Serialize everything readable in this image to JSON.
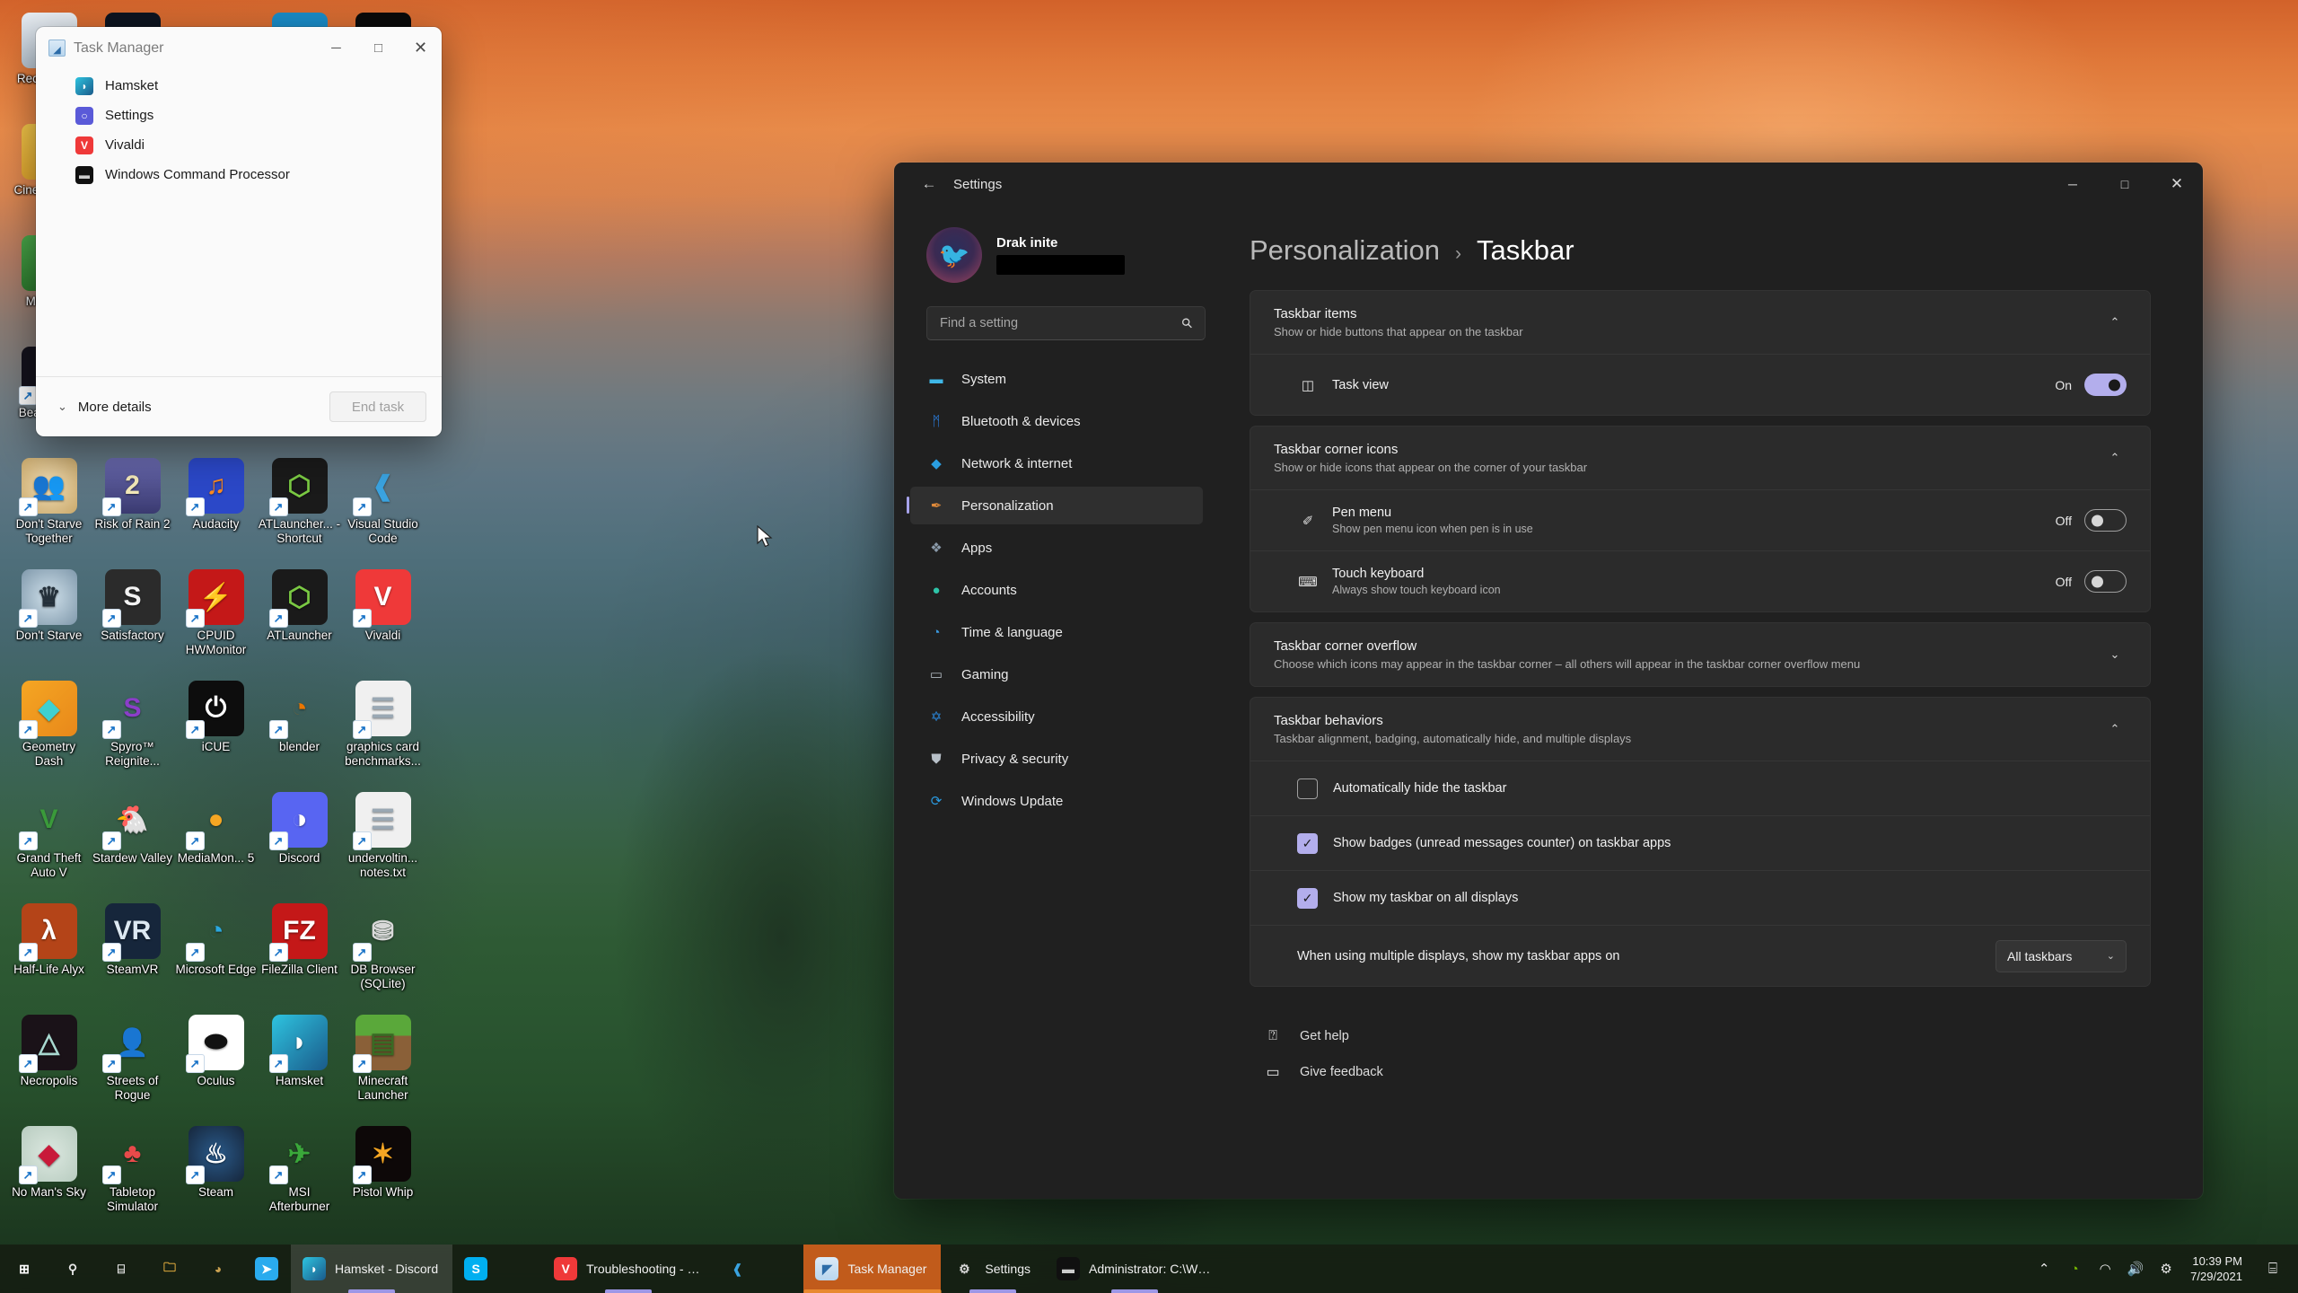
{
  "desktop": {
    "icons": [
      {
        "label": "Recycle Bin",
        "icon": "recycle-bin-icon",
        "glyph": "♻",
        "bg": "linear-gradient(180deg,#e8edf2,#b9c6d2)",
        "color": "#1e7ac8",
        "shortcut": false
      },
      {
        "label": "",
        "icon": "monster-hunter-icon",
        "glyph": "⚔",
        "bg": "#0d1420",
        "color": "#e8eef5",
        "shortcut": false
      },
      {
        "label": "",
        "icon": "green-orb-icon",
        "glyph": "●",
        "bg": "transparent",
        "color": "#2bb24c",
        "shortcut": false
      },
      {
        "label": "",
        "icon": "blue-app-icon",
        "glyph": "▬",
        "bg": "#1a8cc8",
        "color": "#ffffff",
        "shortcut": false
      },
      {
        "label": "",
        "icon": "gauge-icon",
        "glyph": "◔",
        "bg": "#0a0a0a",
        "color": "#e6e6e6",
        "shortcut": false
      },
      {
        "label": "Cinebench R",
        "icon": "cinebench-icon",
        "glyph": "▮",
        "bg": "linear-gradient(180deg,#f5c84a,#e0a72f)",
        "color": "#7a5410",
        "shortcut": false
      },
      {
        "label": "",
        "icon": "placeholder-icon",
        "glyph": "",
        "bg": "transparent",
        "color": "#fff",
        "shortcut": false
      },
      {
        "label": "",
        "icon": "placeholder-icon",
        "glyph": "",
        "bg": "transparent",
        "color": "#fff",
        "shortcut": false
      },
      {
        "label": "",
        "icon": "placeholder-icon",
        "glyph": "",
        "bg": "transparent",
        "color": "#fff",
        "shortcut": false
      },
      {
        "label": "",
        "icon": "placeholder-icon",
        "glyph": "",
        "bg": "transparent",
        "color": "#fff",
        "shortcut": false
      },
      {
        "label": "Memtest",
        "icon": "memtest-ram-icon",
        "glyph": "⌸",
        "bg": "linear-gradient(180deg,#4aa84a,#2e7a2e)",
        "color": "#0d2a0d",
        "shortcut": false
      },
      {
        "label": "",
        "icon": "placeholder-icon",
        "glyph": "",
        "bg": "transparent",
        "color": "#fff",
        "shortcut": false
      },
      {
        "label": "",
        "icon": "placeholder-icon",
        "glyph": "",
        "bg": "transparent",
        "color": "#fff",
        "shortcut": false
      },
      {
        "label": "",
        "icon": "placeholder-icon",
        "glyph": "",
        "bg": "transparent",
        "color": "#fff",
        "shortcut": false
      },
      {
        "label": "",
        "icon": "placeholder-icon",
        "glyph": "",
        "bg": "transparent",
        "color": "#fff",
        "shortcut": false
      },
      {
        "label": "Beat Saber",
        "icon": "beat-saber-icon",
        "glyph": "◆",
        "bg": "#14121c",
        "color": "#e0365c",
        "shortcut": true
      },
      {
        "label": "",
        "icon": "placeholder-icon",
        "glyph": "",
        "bg": "transparent",
        "color": "#fff",
        "shortcut": false
      },
      {
        "label": "",
        "icon": "placeholder-icon",
        "glyph": "",
        "bg": "transparent",
        "color": "#fff",
        "shortcut": false
      },
      {
        "label": "",
        "icon": "placeholder-icon",
        "glyph": "",
        "bg": "transparent",
        "color": "#fff",
        "shortcut": false
      },
      {
        "label": "",
        "icon": "placeholder-icon",
        "glyph": "",
        "bg": "transparent",
        "color": "#fff",
        "shortcut": false
      },
      {
        "label": "Don't Starve Together",
        "icon": "dont-starve-together-icon",
        "glyph": "👥",
        "bg": "radial-gradient(circle,#f0dcb4,#c9a86a)",
        "color": "#3a2a18",
        "shortcut": true
      },
      {
        "label": "Risk of Rain 2",
        "icon": "risk-of-rain-2-icon",
        "glyph": "2",
        "bg": "linear-gradient(180deg,#6a6ab0,#3a3a70)",
        "color": "#f2e8b8",
        "shortcut": true
      },
      {
        "label": "Audacity",
        "icon": "audacity-icon",
        "glyph": "♫",
        "bg": "#2b48c8",
        "color": "#ff8a1e",
        "shortcut": true
      },
      {
        "label": "ATLauncher... - Shortcut",
        "icon": "atlauncher-shortcut-icon",
        "glyph": "⬡",
        "bg": "#1a1a1a",
        "color": "#7ac943",
        "shortcut": true
      },
      {
        "label": "Visual Studio Code",
        "icon": "visual-studio-code-icon",
        "glyph": "❰",
        "bg": "transparent",
        "color": "#3aa3e0",
        "shortcut": true
      },
      {
        "label": "Don't Starve",
        "icon": "dont-starve-icon",
        "glyph": "♛",
        "bg": "radial-gradient(circle,#cfe0ea,#7f98ab)",
        "color": "#24303a",
        "shortcut": true
      },
      {
        "label": "Satisfactory",
        "icon": "satisfactory-icon",
        "glyph": "S",
        "bg": "#2b2b2b",
        "color": "#f2f2f2",
        "shortcut": true
      },
      {
        "label": "CPUID HWMonitor",
        "icon": "cpuid-hwmonitor-icon",
        "glyph": "⚡",
        "bg": "#c41818",
        "color": "#ffffff",
        "shortcut": true
      },
      {
        "label": "ATLauncher",
        "icon": "atlauncher-icon",
        "glyph": "⬡",
        "bg": "#1a1a1a",
        "color": "#7ac943",
        "shortcut": true
      },
      {
        "label": "Vivaldi",
        "icon": "vivaldi-icon",
        "glyph": "V",
        "bg": "#ef3939",
        "color": "#ffffff",
        "shortcut": true
      },
      {
        "label": "Geometry Dash",
        "icon": "geometry-dash-icon",
        "glyph": "◆",
        "bg": "linear-gradient(135deg,#f5a623,#e8881a)",
        "color": "#3fd0d0",
        "shortcut": true
      },
      {
        "label": "Spyro™ Reignite...",
        "icon": "spyro-reignited-icon",
        "glyph": "S",
        "bg": "transparent",
        "color": "#8b3ec9",
        "shortcut": true
      },
      {
        "label": "iCUE",
        "icon": "icue-icon",
        "glyph": "⏻",
        "bg": "#0d0d0d",
        "color": "#ffffff",
        "shortcut": true
      },
      {
        "label": "blender",
        "icon": "blender-icon",
        "glyph": "◔",
        "bg": "transparent",
        "color": "#ea7600",
        "shortcut": true
      },
      {
        "label": "graphics card benchmarks...",
        "icon": "text-document-icon",
        "glyph": "☰",
        "bg": "#f0f0f0",
        "color": "#9aa8b4",
        "shortcut": true
      },
      {
        "label": "Grand Theft Auto V",
        "icon": "grand-theft-auto-v-icon",
        "glyph": "V",
        "bg": "transparent",
        "color": "#3a9a3a",
        "shortcut": true
      },
      {
        "label": "Stardew Valley",
        "icon": "stardew-valley-icon",
        "glyph": "🐔",
        "bg": "transparent",
        "color": "#e8c070",
        "shortcut": true
      },
      {
        "label": "MediaMon... 5",
        "icon": "mediamonkey-icon",
        "glyph": "●",
        "bg": "transparent",
        "color": "#f5a623",
        "shortcut": true
      },
      {
        "label": "Discord",
        "icon": "discord-icon",
        "glyph": "◑",
        "bg": "#5865f2",
        "color": "#ffffff",
        "shortcut": true
      },
      {
        "label": "undervoltin... notes.txt",
        "icon": "text-document-icon",
        "glyph": "☰",
        "bg": "#f0f0f0",
        "color": "#9aa8b4",
        "shortcut": true
      },
      {
        "label": "Half-Life Alyx",
        "icon": "half-life-alyx-icon",
        "glyph": "λ",
        "bg": "#b44418",
        "color": "#ffffff",
        "shortcut": true
      },
      {
        "label": "SteamVR",
        "icon": "steamvr-icon",
        "glyph": "VR",
        "bg": "#16263b",
        "color": "#dce8f2",
        "shortcut": true
      },
      {
        "label": "Microsoft Edge",
        "icon": "microsoft-edge-icon",
        "glyph": "◔",
        "bg": "transparent",
        "color": "#2aa8e0",
        "shortcut": true
      },
      {
        "label": "FileZilla Client",
        "icon": "filezilla-client-icon",
        "glyph": "FZ",
        "bg": "#c41818",
        "color": "#ffffff",
        "shortcut": true
      },
      {
        "label": "DB Browser (SQLite)",
        "icon": "db-browser-sqlite-icon",
        "glyph": "⛃",
        "bg": "transparent",
        "color": "#d8d8d8",
        "shortcut": true
      },
      {
        "label": "Necropolis",
        "icon": "necropolis-icon",
        "glyph": "△",
        "bg": "#1a1218",
        "color": "#a8d8d0",
        "shortcut": true
      },
      {
        "label": "Streets of Rogue",
        "icon": "streets-of-rogue-icon",
        "glyph": "👤",
        "bg": "transparent",
        "color": "#e8c89a",
        "shortcut": true
      },
      {
        "label": "Oculus",
        "icon": "oculus-icon",
        "glyph": "⬬",
        "bg": "#ffffff",
        "color": "#111111",
        "shortcut": true
      },
      {
        "label": "Hamsket",
        "icon": "hamsket-icon",
        "glyph": "◗",
        "bg": "linear-gradient(135deg,#2ec4e0,#1a5a8a)",
        "color": "#ffffff",
        "shortcut": true
      },
      {
        "label": "Minecraft Launcher",
        "icon": "minecraft-launcher-icon",
        "glyph": "▤",
        "bg": "linear-gradient(180deg,#5aa83a 38%,#8a6038 38%)",
        "color": "#3a6a24",
        "shortcut": true
      },
      {
        "label": "No Man's Sky",
        "icon": "no-mans-sky-icon",
        "glyph": "◆",
        "bg": "radial-gradient(circle,#dce8e0,#b8ccc0)",
        "color": "#c81a3a",
        "shortcut": true
      },
      {
        "label": "Tabletop Simulator",
        "icon": "tabletop-simulator-icon",
        "glyph": "♣",
        "bg": "transparent",
        "color": "#e84a4a",
        "shortcut": true
      },
      {
        "label": "Steam",
        "icon": "steam-icon",
        "glyph": "♨",
        "bg": "radial-gradient(circle,#2a5a8a,#16263b)",
        "color": "#ffffff",
        "shortcut": true
      },
      {
        "label": "MSI Afterburner",
        "icon": "msi-afterburner-icon",
        "glyph": "✈",
        "bg": "transparent",
        "color": "#3aa83a",
        "shortcut": true
      },
      {
        "label": "Pistol Whip",
        "icon": "pistol-whip-icon",
        "glyph": "✶",
        "bg": "#0d0808",
        "color": "#f5a623",
        "shortcut": true
      }
    ]
  },
  "task_manager": {
    "title": "Task Manager",
    "app_icon": "task-manager-icon",
    "minimize_label": "─",
    "maximize_label": "□",
    "close_label": "✕",
    "processes": [
      {
        "name": "Hamsket",
        "icon": "hamsket-icon",
        "glyph": "◗",
        "bg": "linear-gradient(135deg,#2ec4e0,#1a5a8a)",
        "color": "#ffffff"
      },
      {
        "name": "Settings",
        "icon": "settings-gear-icon",
        "glyph": "○",
        "bg": "#5a5ad8",
        "color": "#ffffff"
      },
      {
        "name": "Vivaldi",
        "icon": "vivaldi-icon",
        "glyph": "V",
        "bg": "#ef3939",
        "color": "#ffffff"
      },
      {
        "name": "Windows Command Processor",
        "icon": "command-prompt-icon",
        "glyph": "▬",
        "bg": "#101010",
        "color": "#cccccc"
      }
    ],
    "more_details_label": "More details",
    "more_details_chevron": "⌄",
    "end_task_label": "End task"
  },
  "settings": {
    "app_title": "Settings",
    "back_icon": "back-arrow-icon",
    "back_glyph": "←",
    "minimize_label": "─",
    "maximize_label": "□",
    "close_label": "✕",
    "account": {
      "name": "Drak inite",
      "avatar_icon": "user-avatar",
      "avatar_glyph": "🐦"
    },
    "search": {
      "placeholder": "Find a setting",
      "value": "",
      "icon": "search-icon",
      "glyph": "⚲"
    },
    "nav": [
      {
        "label": "System",
        "icon": "system-icon",
        "glyph": "▬",
        "color": "#3fb8e8"
      },
      {
        "label": "Bluetooth & devices",
        "icon": "bluetooth-icon",
        "glyph": "ᛗ",
        "color": "#2a7ee0"
      },
      {
        "label": "Network & internet",
        "icon": "network-icon",
        "glyph": "◆",
        "color": "#2a9ee0"
      },
      {
        "label": "Personalization",
        "icon": "personalization-brush-icon",
        "glyph": "✒",
        "color": "#e08a3a",
        "active": true
      },
      {
        "label": "Apps",
        "icon": "apps-icon",
        "glyph": "❖",
        "color": "#8a9aaa"
      },
      {
        "label": "Accounts",
        "icon": "accounts-icon",
        "glyph": "●",
        "color": "#2ec4a8"
      },
      {
        "label": "Time & language",
        "icon": "time-language-icon",
        "glyph": "◔",
        "color": "#3a9ae0"
      },
      {
        "label": "Gaming",
        "icon": "gaming-controller-icon",
        "glyph": "▭",
        "color": "#b0b8c0"
      },
      {
        "label": "Accessibility",
        "icon": "accessibility-icon",
        "glyph": "✡",
        "color": "#2a8ae0"
      },
      {
        "label": "Privacy & security",
        "icon": "shield-icon",
        "glyph": "⛊",
        "color": "#b8c0c8"
      },
      {
        "label": "Windows Update",
        "icon": "windows-update-icon",
        "glyph": "⟳",
        "color": "#2a9ae0"
      }
    ],
    "breadcrumb": {
      "parent": "Personalization",
      "separator": "›",
      "current": "Taskbar"
    },
    "cards": [
      {
        "title": "Taskbar items",
        "subtitle": "Show or hide buttons that appear on the taskbar",
        "chevron": "⌃",
        "rows": [
          {
            "kind": "toggle",
            "title": "Task view",
            "sub": "",
            "icon": "task-view-icon",
            "glyph": "◫",
            "state": "On",
            "on": true
          }
        ]
      },
      {
        "title": "Taskbar corner icons",
        "subtitle": "Show or hide icons that appear on the corner of your taskbar",
        "chevron": "⌃",
        "rows": [
          {
            "kind": "toggle",
            "title": "Pen menu",
            "sub": "Show pen menu icon when pen is in use",
            "icon": "pen-icon",
            "glyph": "✐",
            "state": "Off",
            "on": false
          },
          {
            "kind": "toggle",
            "title": "Touch keyboard",
            "sub": "Always show touch keyboard icon",
            "icon": "touch-keyboard-icon",
            "glyph": "⌨",
            "state": "Off",
            "on": false
          }
        ]
      },
      {
        "title": "Taskbar corner overflow",
        "subtitle": "Choose which icons may appear in the taskbar corner – all others will appear in the taskbar corner overflow menu",
        "chevron": "⌄",
        "rows": []
      },
      {
        "title": "Taskbar behaviors",
        "subtitle": "Taskbar alignment, badging, automatically hide, and multiple displays",
        "chevron": "⌃",
        "rows": [
          {
            "kind": "checkbox",
            "title": "Automatically hide the taskbar",
            "checked": false
          },
          {
            "kind": "checkbox",
            "title": "Show badges (unread messages counter) on taskbar apps",
            "checked": true
          },
          {
            "kind": "checkbox",
            "title": "Show my taskbar on all displays",
            "checked": true
          },
          {
            "kind": "select",
            "title": "When using multiple displays, show my taskbar apps on",
            "value": "All taskbars",
            "chevron": "⌄"
          }
        ]
      }
    ],
    "links": [
      {
        "label": "Get help",
        "icon": "get-help-icon",
        "glyph": "⍰"
      },
      {
        "label": "Give feedback",
        "icon": "give-feedback-icon",
        "glyph": "▭"
      }
    ]
  },
  "taskbar": {
    "pinned": [
      {
        "name": "start-button",
        "label": "",
        "icon": "windows-start-icon",
        "glyph": "⊞",
        "bg": "transparent",
        "color": "#ffffff"
      },
      {
        "name": "search-button",
        "label": "",
        "icon": "search-icon",
        "glyph": "⚲",
        "bg": "transparent",
        "color": "#e8e8e8"
      },
      {
        "name": "task-view-button",
        "label": "",
        "icon": "task-view-icon",
        "glyph": "⌸",
        "bg": "transparent",
        "color": "#e8e8e8"
      },
      {
        "name": "file-explorer-button",
        "label": "",
        "icon": "file-explorer-icon",
        "glyph": "🗀",
        "bg": "transparent",
        "color": "#f5b942"
      },
      {
        "name": "game-app-button",
        "label": "",
        "icon": "dark-souls-icon",
        "glyph": "◕",
        "bg": "transparent",
        "color": "#c8a050"
      },
      {
        "name": "telegram-button",
        "label": "",
        "icon": "telegram-icon",
        "glyph": "➤",
        "bg": "#2aabee",
        "color": "#ffffff"
      }
    ],
    "tasks": [
      {
        "label": "Hamsket - Discord",
        "icon": "hamsket-icon",
        "glyph": "◗",
        "bg": "linear-gradient(135deg,#2ec4e0,#1a5a8a)",
        "color": "#ffffff",
        "state": "grey",
        "running": true
      },
      {
        "label": "",
        "icon": "skype-icon",
        "glyph": "S",
        "bg": "#00aff0",
        "color": "#ffffff",
        "state": "none",
        "running": false
      },
      {
        "label": "Troubleshooting - …",
        "icon": "vivaldi-icon",
        "glyph": "V",
        "bg": "#ef3939",
        "color": "#ffffff",
        "state": "none",
        "running": true
      },
      {
        "label": "",
        "icon": "visual-studio-code-icon",
        "glyph": "❰",
        "bg": "transparent",
        "color": "#3aa3e0",
        "state": "none",
        "running": false
      },
      {
        "label": "Task Manager",
        "icon": "task-manager-icon",
        "glyph": "◤",
        "bg": "linear-gradient(180deg,#dbeaf7,#b9d6ee)",
        "color": "#2c6ca8",
        "state": "orange",
        "running": true
      },
      {
        "label": "Settings",
        "icon": "settings-gear-icon",
        "glyph": "⚙",
        "bg": "transparent",
        "color": "#d8d8d8",
        "state": "none",
        "running": true
      },
      {
        "label": "Administrator: C:\\W…",
        "icon": "command-prompt-icon",
        "glyph": "▬",
        "bg": "#101010",
        "color": "#cccccc",
        "state": "none",
        "running": true
      }
    ],
    "tray": [
      {
        "name": "show-hidden-icons",
        "icon": "chevron-up-icon",
        "glyph": "⌃",
        "color": "#e8e8e8"
      },
      {
        "name": "nvidia-icon",
        "icon": "nvidia-icon",
        "glyph": "◔",
        "color": "#76b900"
      },
      {
        "name": "wifi-icon",
        "icon": "wifi-icon",
        "glyph": "◠",
        "color": "#e8e8e8"
      },
      {
        "name": "volume-icon",
        "icon": "volume-icon",
        "glyph": "🔊",
        "color": "#e8e8e8"
      },
      {
        "name": "settings-gear-tray",
        "icon": "gear-icon",
        "glyph": "⚙",
        "color": "#e8e8e8"
      }
    ],
    "clock": {
      "time": "10:39 PM",
      "date": "7/29/2021"
    },
    "notifications": {
      "icon": "notifications-icon",
      "glyph": "⌸"
    }
  },
  "colors": {
    "accent": "#b3aeec",
    "settings_bg": "#202020",
    "card_bg": "#2b2b2b",
    "taskbar_bg": "rgba(22,30,18,.92)",
    "active_task_orange": "#c15b1b"
  }
}
